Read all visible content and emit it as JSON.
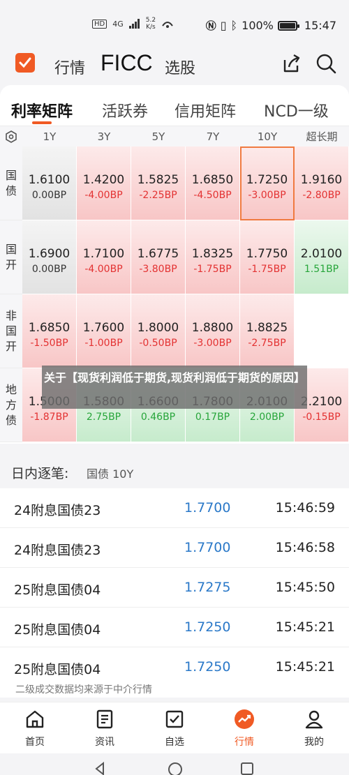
{
  "status_bar": {
    "network": "4G",
    "speed_value": "5.2",
    "speed_unit": "K/s",
    "battery": "100%",
    "time": "15:47"
  },
  "header": {
    "tabs": [
      "行情",
      "FICC",
      "选股"
    ],
    "active_tab": "FICC",
    "brand_color": "#f05a24"
  },
  "subtabs": {
    "items": [
      "利率矩阵",
      "活跃券",
      "信用矩阵",
      "NCD一级"
    ],
    "active": "利率矩阵"
  },
  "matrix": {
    "columns": [
      "1Y",
      "3Y",
      "5Y",
      "7Y",
      "10Y",
      "超长期"
    ],
    "rows": [
      {
        "label": "国债",
        "cells": [
          {
            "value": "1.6100",
            "change": "0.00BP",
            "trend": "flat"
          },
          {
            "value": "1.4200",
            "change": "-4.00BP",
            "trend": "neg"
          },
          {
            "value": "1.5825",
            "change": "-2.25BP",
            "trend": "neg"
          },
          {
            "value": "1.6850",
            "change": "-4.50BP",
            "trend": "neg"
          },
          {
            "value": "1.7250",
            "change": "-3.00BP",
            "trend": "neg",
            "selected": true
          },
          {
            "value": "1.9160",
            "change": "-2.80BP",
            "trend": "neg"
          }
        ]
      },
      {
        "label": "国开",
        "cells": [
          {
            "value": "1.6900",
            "change": "0.00BP",
            "trend": "flat"
          },
          {
            "value": "1.7100",
            "change": "-4.00BP",
            "trend": "neg"
          },
          {
            "value": "1.6775",
            "change": "-3.80BP",
            "trend": "neg"
          },
          {
            "value": "1.8325",
            "change": "-1.75BP",
            "trend": "neg"
          },
          {
            "value": "1.7750",
            "change": "-1.75BP",
            "trend": "neg"
          },
          {
            "value": "2.0100",
            "change": "1.51BP",
            "trend": "pos"
          }
        ]
      },
      {
        "label": "非国开",
        "cells": [
          {
            "value": "1.6850",
            "change": "-1.50BP",
            "trend": "neg"
          },
          {
            "value": "1.7600",
            "change": "-1.00BP",
            "trend": "neg"
          },
          {
            "value": "1.8000",
            "change": "-0.50BP",
            "trend": "neg"
          },
          {
            "value": "1.8800",
            "change": "-3.00BP",
            "trend": "neg"
          },
          {
            "value": "1.8825",
            "change": "-2.75BP",
            "trend": "neg"
          },
          {
            "value": "",
            "change": "",
            "trend": "empty"
          }
        ]
      },
      {
        "label": "地方债",
        "cells": [
          {
            "value": "1.5000",
            "change": "-1.87BP",
            "trend": "neg"
          },
          {
            "value": "1.5800",
            "change": "2.75BP",
            "trend": "pos"
          },
          {
            "value": "1.6600",
            "change": "0.46BP",
            "trend": "pos"
          },
          {
            "value": "1.7800",
            "change": "0.17BP",
            "trend": "pos"
          },
          {
            "value": "2.0100",
            "change": "2.00BP",
            "trend": "pos"
          },
          {
            "value": "2.2100",
            "change": "-0.15BP",
            "trend": "neg"
          }
        ]
      }
    ]
  },
  "overlay_caption": "关于【现货利润低于期货,现货利润低于期货的原因】",
  "intraday": {
    "title": "日内逐笔:",
    "subtitle": "国债 10Y",
    "trades": [
      {
        "name": "24附息国债23",
        "price": "1.7700",
        "time": "15:46:59"
      },
      {
        "name": "24附息国债23",
        "price": "1.7700",
        "time": "15:46:58"
      },
      {
        "name": "25附息国债04",
        "price": "1.7275",
        "time": "15:45:50"
      },
      {
        "name": "25附息国债04",
        "price": "1.7250",
        "time": "15:45:21"
      },
      {
        "name": "25附息国债04",
        "price": "1.7250",
        "time": "15:45:21"
      }
    ],
    "footnote": "二级成交数据均来源于中介行情"
  },
  "bottom_nav": {
    "items": [
      "首页",
      "资讯",
      "自选",
      "行情",
      "我的"
    ],
    "active": "行情"
  }
}
